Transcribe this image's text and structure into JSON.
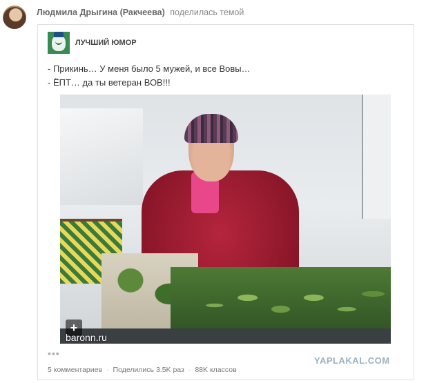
{
  "header": {
    "author": "Людмила Дрыгина (Ракчеева)",
    "action": "поделилась темой"
  },
  "group": {
    "name": "ЛУЧШИЙ ЮМОР"
  },
  "post": {
    "line1": "- Прикинь… У меня было 5 мужей, и все Вовы…",
    "line2": "- ЁПТ… да ты ветеран ВОВ!!!"
  },
  "media": {
    "watermark": "baronn.ru",
    "expand_label": "+"
  },
  "footer": {
    "more": "•••",
    "comments": "5 комментариев",
    "shares": "Поделились 3.5K раз",
    "likes": "88K классов"
  },
  "watermark": "YAPLAKAL.COM",
  "colors": {
    "group_logo_bg": "#3a8a53",
    "text_muted": "#777777",
    "yaplakal": "#9ab2c2"
  }
}
